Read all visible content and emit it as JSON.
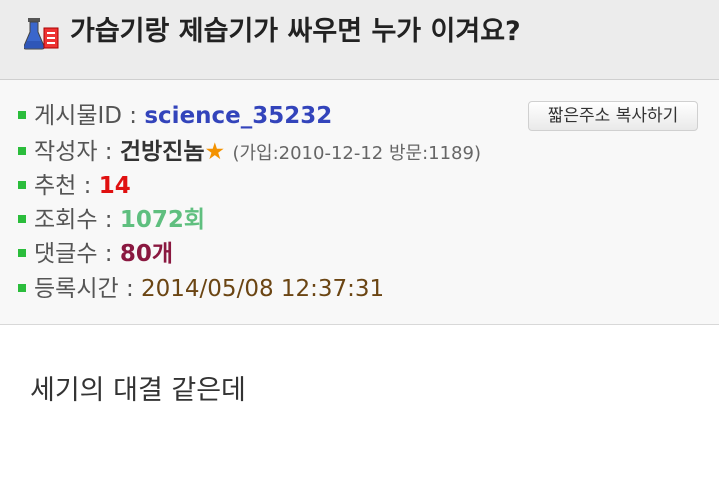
{
  "post": {
    "title": "가습기랑 제습기가 싸우면 누가 이겨요?",
    "title_icon": "flask-icon",
    "copy_button_label": "짧은주소 복사하기",
    "fields": {
      "id_label": "게시물ID : ",
      "id_value": "science_35232",
      "author_label": "작성자 : ",
      "author_value": "건방진놈",
      "author_star": "★",
      "author_meta": "(가입:2010-12-12 방문:1189)",
      "recommend_label": "추천 : ",
      "recommend_value": "14",
      "views_label": "조회수 : ",
      "views_value": "1072회",
      "comments_label": "댓글수 : ",
      "comments_value": "80개",
      "date_label": "등록시간 : ",
      "date_value": "2014/05/08 12:37:31"
    },
    "body": "세기의 대결 같은데"
  },
  "colors": {
    "bullet": "#2bbd3c",
    "id": "#3344bb",
    "recommend": "#e01010",
    "views": "#5fbf7f",
    "comments": "#8a1840",
    "date": "#6b4513",
    "star": "#f39200"
  }
}
